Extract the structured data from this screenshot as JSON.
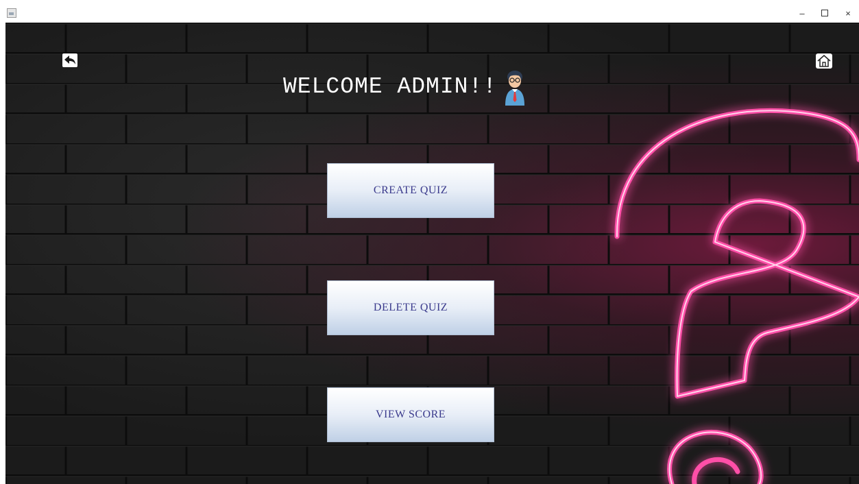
{
  "window": {
    "controls": {
      "minimize": "–",
      "close": "×"
    }
  },
  "header": {
    "welcome": "WELCOME ADMIN!!"
  },
  "menu": {
    "create_quiz": "CREATE QUIZ",
    "delete_quiz": "DELETE QUIZ",
    "view_score": "VIEW SCORE"
  },
  "icons": {
    "back": "back-arrow-icon",
    "home": "home-icon",
    "admin": "admin-avatar-icon",
    "background_symbol": "question-mark"
  },
  "colors": {
    "background": "#1b1b1b",
    "neon": "#ff4fa8",
    "button_text": "#3a3a8c",
    "button_top": "#ffffff",
    "button_bottom": "#bfd0e6"
  }
}
